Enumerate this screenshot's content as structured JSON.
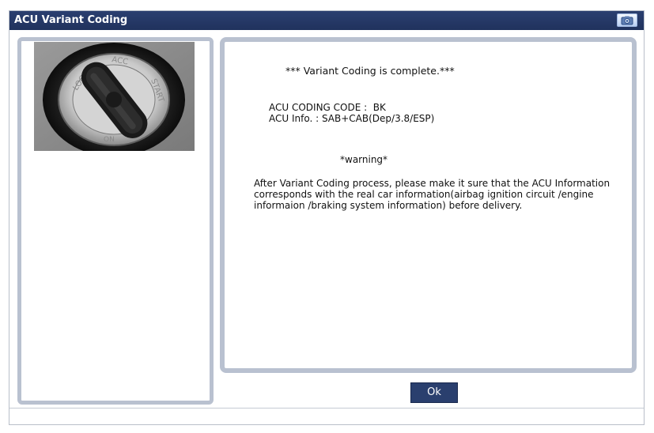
{
  "window": {
    "title": "ACU Variant Coding",
    "icon": "camera-icon"
  },
  "left_panel": {
    "image": "ignition-switch-photo",
    "switch_labels": [
      "LOCK",
      "ACC",
      "START",
      "ON"
    ]
  },
  "message": {
    "title": "*** Variant Coding is complete.***",
    "code_line": "ACU CODING CODE :  BK",
    "info_line": "ACU Info. : SAB+CAB(Dep/3.8/ESP)",
    "warning_title": "*warning*",
    "warning_body": "After Variant Coding process, please make it sure that the ACU Information corresponds with the real car information(airbag ignition circuit /engine informaion /braking system information) before delivery."
  },
  "buttons": {
    "ok_label": "Ok"
  },
  "colors": {
    "titlebar": "#24375f",
    "panel_border": "#b9c1d0",
    "button": "#2a3f6e"
  }
}
